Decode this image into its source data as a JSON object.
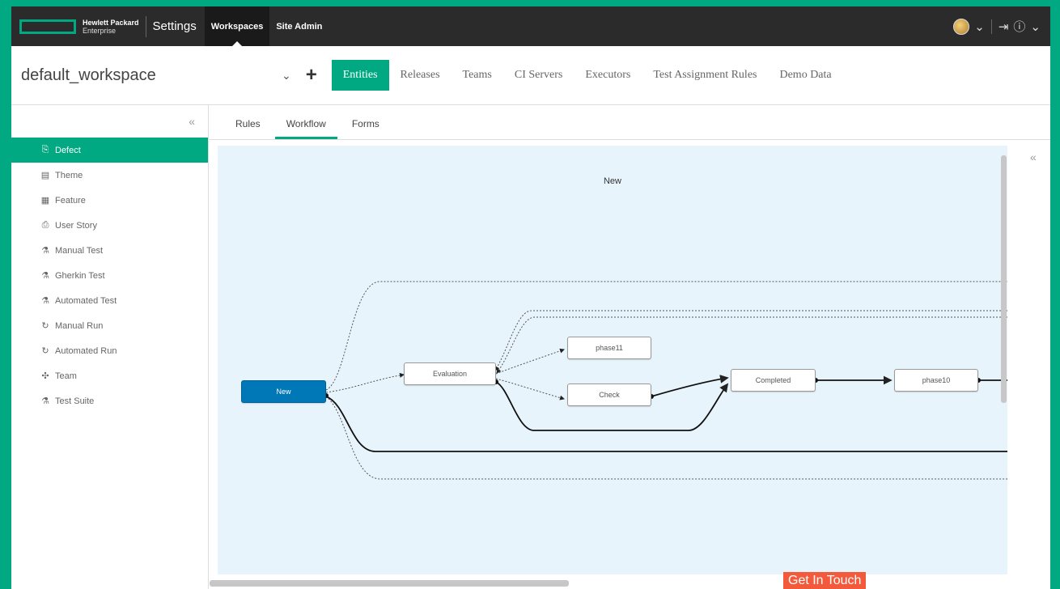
{
  "topbar": {
    "brand_line1": "Hewlett Packard",
    "brand_line2": "Enterprise",
    "app_title": "Settings",
    "nav": [
      {
        "label": "Workspaces",
        "active": true
      },
      {
        "label": "Site Admin",
        "active": false
      }
    ],
    "icons": [
      "avatar",
      "chevron-down-icon",
      "sign-out-icon",
      "help-icon",
      "chevron-down-icon"
    ]
  },
  "workspace": {
    "name": "default_workspace",
    "dropdown_icon": "chevron-down-icon",
    "add_icon": "plus-icon",
    "tabs": [
      {
        "label": "Entities",
        "active": true
      },
      {
        "label": "Releases"
      },
      {
        "label": "Teams"
      },
      {
        "label": "CI Servers"
      },
      {
        "label": "Executors"
      },
      {
        "label": "Test Assignment Rules"
      },
      {
        "label": "Demo Data"
      }
    ]
  },
  "sidebar": {
    "collapse_icon": "double-chevron-left-icon",
    "items": [
      {
        "label": "Defect",
        "icon": "defect-icon",
        "active": true
      },
      {
        "label": "Theme",
        "icon": "theme-icon"
      },
      {
        "label": "Feature",
        "icon": "feature-icon"
      },
      {
        "label": "User Story",
        "icon": "user-story-icon"
      },
      {
        "label": "Manual Test",
        "icon": "manual-test-icon"
      },
      {
        "label": "Gherkin Test",
        "icon": "gherkin-test-icon"
      },
      {
        "label": "Automated Test",
        "icon": "automated-test-icon"
      },
      {
        "label": "Manual Run",
        "icon": "manual-run-icon"
      },
      {
        "label": "Automated Run",
        "icon": "automated-run-icon"
      },
      {
        "label": "Team",
        "icon": "team-icon"
      },
      {
        "label": "Test Suite",
        "icon": "test-suite-icon"
      }
    ]
  },
  "subtabs": [
    {
      "label": "Rules"
    },
    {
      "label": "Workflow",
      "active": true
    },
    {
      "label": "Forms"
    }
  ],
  "workflow": {
    "selected_phase": "New",
    "nodes": {
      "new": "New",
      "evaluation": "Evaluation",
      "phase11": "phase11",
      "check": "Check",
      "completed": "Completed",
      "phase10": "phase10"
    }
  },
  "footer": {
    "get_in_touch": "Get In Touch"
  },
  "colors": {
    "accent": "#01a982",
    "start_node": "#0077b6",
    "topbar": "#2b2b2b",
    "canvas": "#e8f4fb",
    "get_in_touch": "#f35a3c"
  }
}
